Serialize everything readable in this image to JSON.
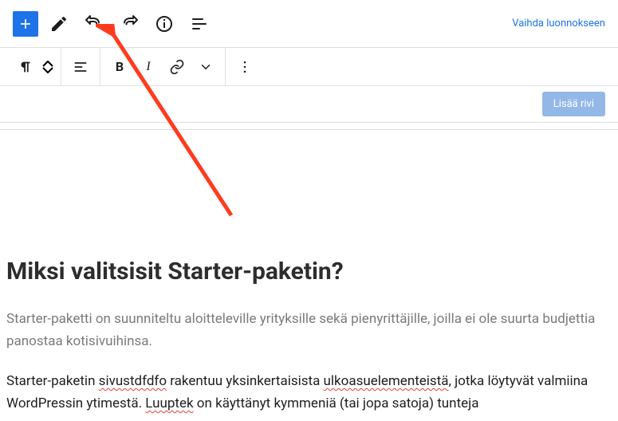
{
  "header": {
    "draft_link": "Vaihda luonnokseen"
  },
  "row": {
    "add_label": "Lisää rivi"
  },
  "content": {
    "heading": "Miksi valitsisit Starter-paketin?",
    "para1": "Starter-paketti on suunniteltu aloitteleville yrityksille sekä pienyrittäjille, joilla ei ole suurta budjettia panostaa kotisivuihinsa.",
    "p2_a": "Starter-paketin ",
    "p2_spell1": "sivustdfdfo",
    "p2_b": " rakentuu yksinkertaisista ",
    "p2_spell2": "ulkoasuelementeistä",
    "p2_c": ", jotka löytyvät valmiina WordPressin ytimestä. ",
    "p2_spell3": "Luuptek",
    "p2_d": " on käyttänyt kymmeniä (tai jopa satoja) tunteja"
  },
  "format": {
    "bold": "B",
    "italic": "I"
  }
}
